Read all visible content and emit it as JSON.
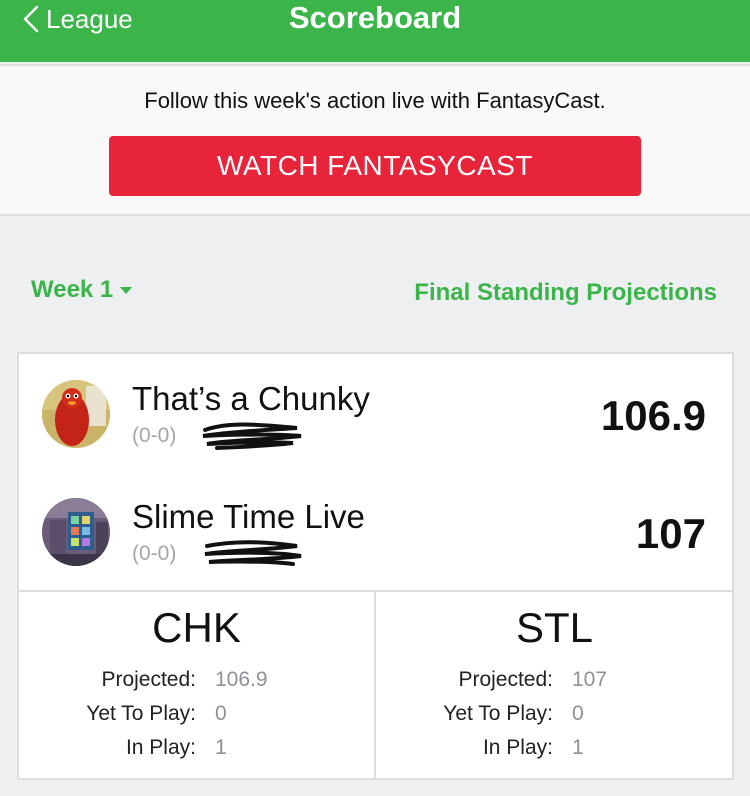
{
  "header": {
    "back_label": "League",
    "title": "Scoreboard",
    "color": "#3bb54a"
  },
  "promo": {
    "text": "Follow this week's action live with FantasyCast.",
    "button_label": "WATCH FANTASYCAST",
    "button_color": "#e8243a"
  },
  "week_selector": {
    "label": "Week 1",
    "icon": "caret-down-icon"
  },
  "projections_link": "Final Standing Projections",
  "matchup": {
    "teams": [
      {
        "name": "That’s a Chunky",
        "record": "(0-0)",
        "score": "106.9",
        "avatar_icon": "team-avatar-red-icon"
      },
      {
        "name": "Slime Time Live",
        "record": "(0-0)",
        "score": "107",
        "avatar_icon": "team-avatar-slime-icon"
      }
    ],
    "stats": [
      {
        "abbr": "CHK",
        "projected_label": "Projected:",
        "projected": "106.9",
        "yet_to_play_label": "Yet To Play:",
        "yet_to_play": "0",
        "in_play_label": "In Play:",
        "in_play": "1"
      },
      {
        "abbr": "STL",
        "projected_label": "Projected:",
        "projected": "107",
        "yet_to_play_label": "Yet To Play:",
        "yet_to_play": "0",
        "in_play_label": "In Play:",
        "in_play": "1"
      }
    ]
  }
}
